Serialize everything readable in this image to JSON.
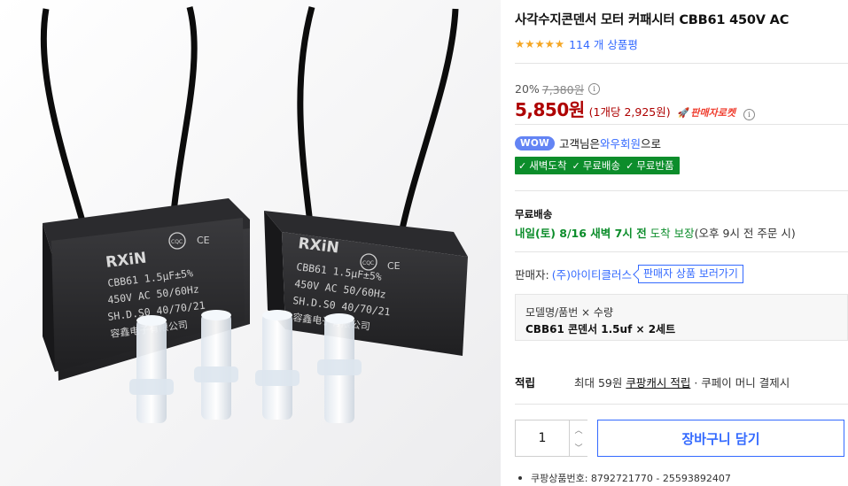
{
  "product": {
    "title": "사각수지콘덴서 모터 커패시터 CBB61 450V AC",
    "review_count": "114 개 상품평",
    "rating_stars": 5,
    "discount_rate": "20%",
    "original_price": "7,380원",
    "sale_price": "5,850원",
    "unit_price": "(1개당 2,925원)",
    "seller_rocket": "판매자로켓",
    "image": {
      "capacitor_brand": "RXiN",
      "capacitor_cert": "CQC",
      "capacitor_ce": "CE",
      "capacitor_line1": "CBB61  1.5μF±5%",
      "capacitor_line2": "450V AC   50/60Hz",
      "capacitor_line3": "SH.D.S0     40/70/21",
      "capacitor_line4": "容鑫电子有限公司"
    }
  },
  "wow": {
    "badge": "WOW",
    "text_prefix": "고객님은 ",
    "link": "와우회원",
    "text_suffix": "으로",
    "benefits": [
      "새벽도착",
      "무료배송",
      "무료반품"
    ]
  },
  "shipping": {
    "label": "무료배송",
    "date": "내일(토) 8/16 새벽 7시 전",
    "guarantee": " 도착 보장",
    "note": "(오후 9시 전 주문 시)"
  },
  "seller": {
    "label": "판매자:",
    "name": "(주)아이티클러스",
    "button": "판매자 상품 보러가기"
  },
  "option": {
    "label": "모델명/품번 × 수량",
    "value": "CBB61 콘덴서 1.5uf × 2세트"
  },
  "cash": {
    "label": "적립",
    "prefix": "최대 59원 ",
    "link": "쿠팡캐시 적립",
    "suffix": " · 쿠페이 머니 결제시"
  },
  "purchase": {
    "quantity": "1",
    "cart_button": "장바구니 담기"
  },
  "product_number": "쿠팡상품번호: 8792721770 - 25593892407",
  "colors": {
    "price_red": "#ae0000",
    "link_blue": "#346aff",
    "green": "#0c8d2b",
    "wow_badge": "#6384f4",
    "star": "#f5a623"
  }
}
